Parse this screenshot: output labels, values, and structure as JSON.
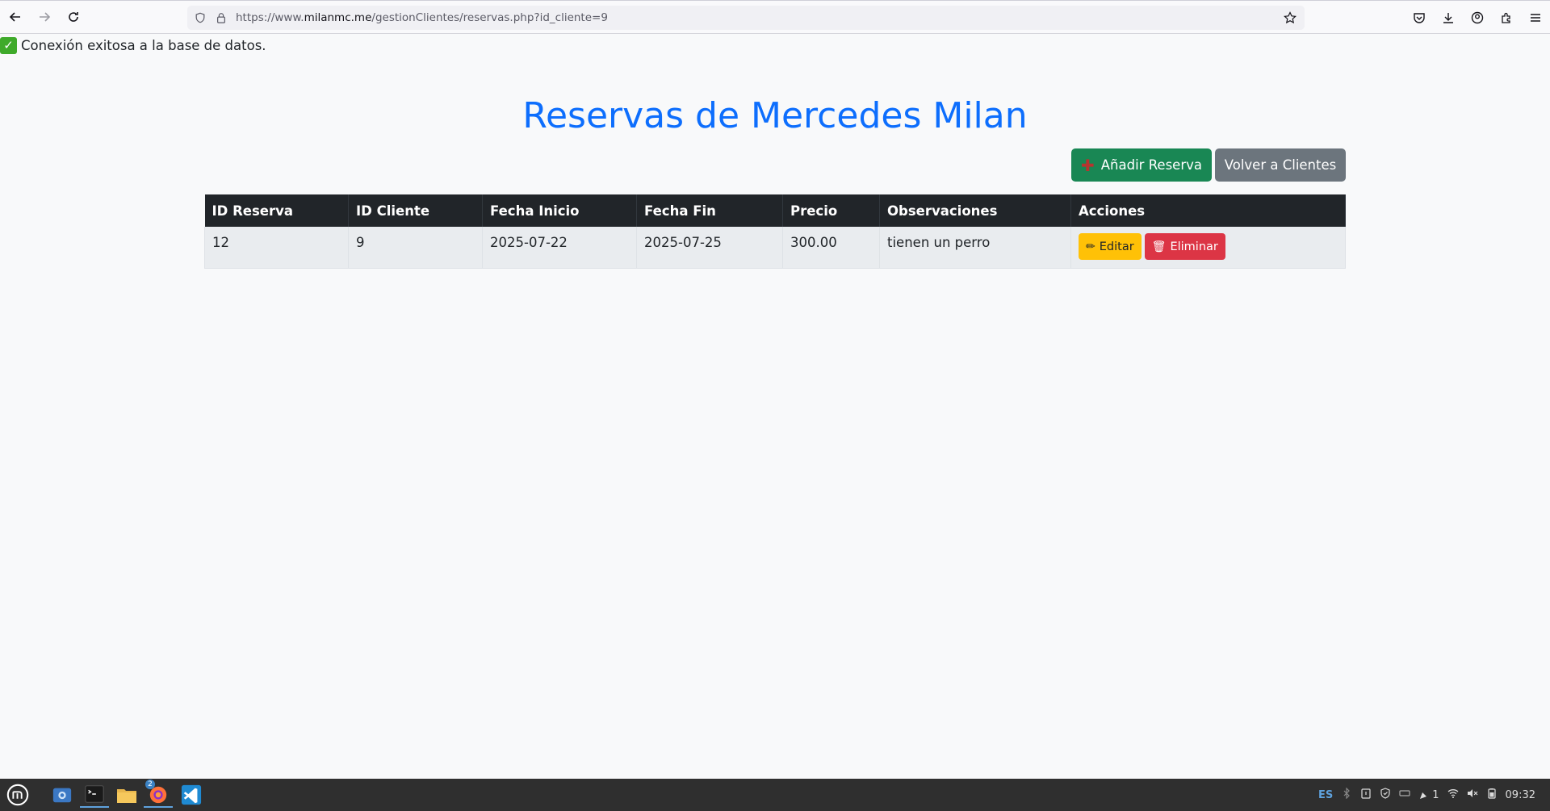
{
  "browser": {
    "url_prefix": "https://www.",
    "url_host": "milanmc.me",
    "url_path": "/gestionClientes/reservas.php?id_cliente=9"
  },
  "page": {
    "connection_message": "Conexión exitosa a la base de datos.",
    "title": "Reservas de Mercedes Milan",
    "add_button_label": "Añadir Reserva",
    "back_button_label": "Volver a Clientes"
  },
  "table": {
    "headers": [
      "ID Reserva",
      "ID Cliente",
      "Fecha Inicio",
      "Fecha Fin",
      "Precio",
      "Observaciones",
      "Acciones"
    ],
    "rows": [
      {
        "id_reserva": "12",
        "id_cliente": "9",
        "fecha_inicio": "2025-07-22",
        "fecha_fin": "2025-07-25",
        "precio": "300.00",
        "observaciones": "tienen un perro",
        "edit_label": "Editar",
        "delete_label": "Eliminar"
      }
    ]
  },
  "taskbar": {
    "firefox_badge": "2",
    "keyboard_layout": "ES",
    "notification_count": "1",
    "clock": "09:32"
  },
  "colors": {
    "title": "#0d6efd",
    "add_button": "#198754",
    "back_button": "#6c757d",
    "table_header": "#212529",
    "edit_button": "#ffc107",
    "delete_button": "#dc3545"
  }
}
